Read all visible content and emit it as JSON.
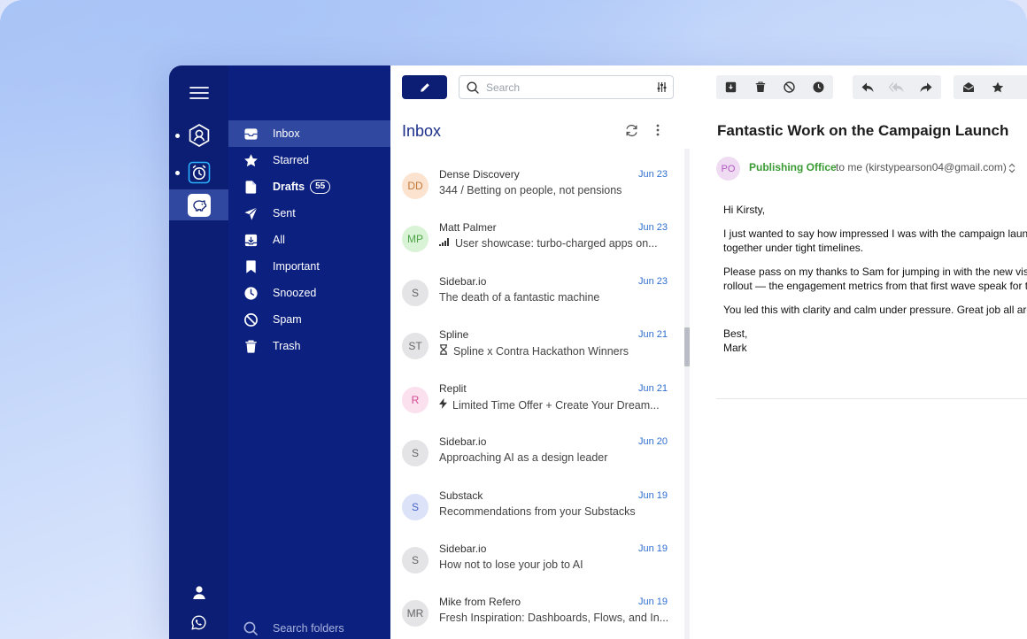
{
  "colors": {
    "rail": "#0b1e73",
    "folders": "#0c2080",
    "active_folder": "#3048a0",
    "accent_blue": "#2f6fd0",
    "from_green": "#3a9a33"
  },
  "rail": {
    "menu_icon": "hamburger-icon",
    "accounts": [
      {
        "icon": "user-hexagon-icon",
        "has_dot": true
      },
      {
        "icon": "alarm-clock-icon",
        "has_dot": true
      },
      {
        "icon": "piggy-bank-icon",
        "active": true
      }
    ],
    "bottom": [
      "profile-icon",
      "whatsapp-icon"
    ]
  },
  "folders": {
    "items": [
      {
        "label": "Inbox",
        "icon": "inbox-icon",
        "active": true
      },
      {
        "label": "Starred",
        "icon": "star-icon"
      },
      {
        "label": "Drafts",
        "icon": "draft-icon",
        "count": "55",
        "bold": true
      },
      {
        "label": "Sent",
        "icon": "send-icon"
      },
      {
        "label": "All",
        "icon": "archive-icon"
      },
      {
        "label": "Important",
        "icon": "bookmark-icon"
      },
      {
        "label": "Snoozed",
        "icon": "clock-icon"
      },
      {
        "label": "Spam",
        "icon": "block-icon"
      },
      {
        "label": "Trash",
        "icon": "trash-icon"
      }
    ],
    "search_placeholder": "Search folders"
  },
  "list": {
    "search_placeholder": "Search",
    "title": "Inbox",
    "messages": [
      {
        "initials": "DD",
        "sender": "Dense Discovery",
        "date": "Jun 23",
        "subject": "344 / Betting on people, not pensions",
        "bg": "#fbe3cf",
        "fg": "#c57a3c"
      },
      {
        "initials": "MP",
        "sender": "Matt Palmer",
        "date": "Jun 23",
        "subject": "User showcase: turbo-charged apps on...",
        "subject_icon": "signal-icon",
        "bg": "#d9f3d6",
        "fg": "#4ea347"
      },
      {
        "initials": "S",
        "sender": "Sidebar.io",
        "date": "Jun 23",
        "subject": "The death of a fantastic machine",
        "bg": "#e4e4e6",
        "fg": "#666"
      },
      {
        "initials": "ST",
        "sender": "Spline",
        "date": "Jun 21",
        "subject": "Spline x Contra Hackathon Winners",
        "subject_icon": "hourglass-icon",
        "bg": "#e4e4e6",
        "fg": "#666"
      },
      {
        "initials": "R",
        "sender": "Replit",
        "date": "Jun 21",
        "subject": "Limited Time Offer + Create Your Dream...",
        "subject_icon": "lightning-icon",
        "bg": "#fbe0ee",
        "fg": "#d24b93"
      },
      {
        "initials": "S",
        "sender": "Sidebar.io",
        "date": "Jun 20",
        "subject": "Approaching AI as a design leader",
        "bg": "#e4e4e6",
        "fg": "#666"
      },
      {
        "initials": "S",
        "sender": "Substack",
        "date": "Jun 19",
        "subject": "Recommendations from your Substacks",
        "bg": "#dce3f8",
        "fg": "#4863c6"
      },
      {
        "initials": "S",
        "sender": "Sidebar.io",
        "date": "Jun 19",
        "subject": "How not to lose your job to AI",
        "bg": "#e4e4e6",
        "fg": "#666"
      },
      {
        "initials": "MR",
        "sender": "Mike from Refero",
        "date": "Jun 19",
        "subject": "Fresh Inspiration: Dashboards, Flows, and In...",
        "bg": "#e4e4e6",
        "fg": "#666"
      }
    ]
  },
  "reader": {
    "title": "Fantastic Work on the Campaign Launch",
    "from_initials": "PO",
    "from_name": "Publishing Office",
    "to_line": "to me (kirstypearson04@gmail.com)",
    "body": [
      "Hi Kirsty,",
      "I just wanted to say how impressed I was with the campaign launch last",
      "together under tight timelines.",
      "Please pass on my thanks to Sam for jumping in with the new visuals s",
      "rollout — the engagement metrics from that first wave speak for themse",
      "You led this with clarity and calm under pressure. Great job all around!",
      "Best,",
      "Mark"
    ]
  }
}
